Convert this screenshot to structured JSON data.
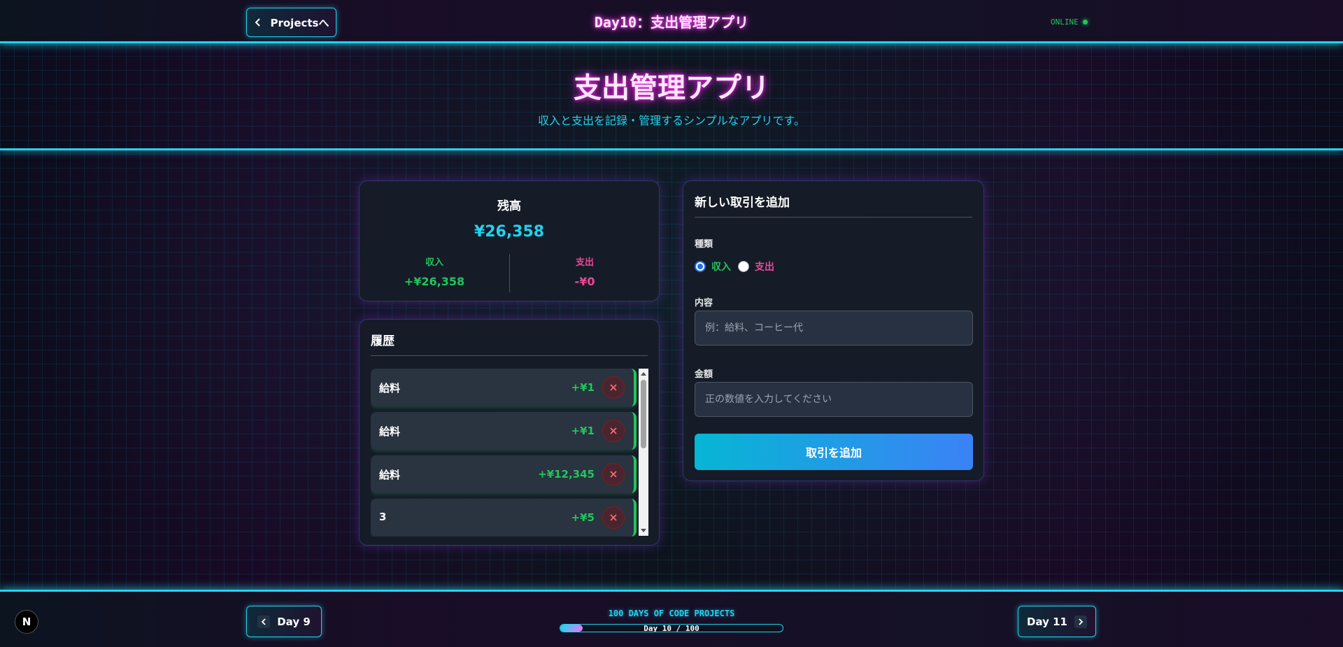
{
  "header": {
    "back_label": "Projectsへ",
    "title": "Day10：支出管理アプリ",
    "status": "ONLINE"
  },
  "hero": {
    "title": "支出管理アプリ",
    "subtitle": "収入と支出を記録・管理するシンプルなアプリです。"
  },
  "balance": {
    "title": "残高",
    "total": "¥26,358",
    "income_label": "収入",
    "income_value": "+¥26,358",
    "expense_label": "支出",
    "expense_value": "-¥0"
  },
  "history": {
    "title": "履歴",
    "items": [
      {
        "name": "給料",
        "amount": "+¥1"
      },
      {
        "name": "給料",
        "amount": "+¥1"
      },
      {
        "name": "給料",
        "amount": "+¥12,345"
      },
      {
        "name": "3",
        "amount": "+¥5"
      }
    ]
  },
  "form": {
    "title": "新しい取引を追加",
    "type_label": "種類",
    "income_option": "収入",
    "expense_option": "支出",
    "selected_type": "収入",
    "content_label": "内容",
    "content_placeholder": "例：給料、コーヒー代",
    "content_value": "",
    "amount_label": "金額",
    "amount_placeholder": "正の数値を入力してください",
    "amount_value": "",
    "submit_label": "取引を追加"
  },
  "footer": {
    "logo": "N",
    "prev_label": "Day 9",
    "next_label": "Day 11",
    "series_label": "100 DAYS OF CODE PROJECTS",
    "progress_text": "Day 10 / 100",
    "progress_fraction": 0.1
  },
  "colors": {
    "accent_cyan": "#22d3ee",
    "accent_magenta": "#ff3df5",
    "income_green": "#22c55e",
    "expense_pink": "#ec4899"
  },
  "icons": {
    "back": "chevron-left-icon",
    "next": "chevron-right-icon",
    "delete": "close-icon",
    "status": "status-dot-icon"
  }
}
